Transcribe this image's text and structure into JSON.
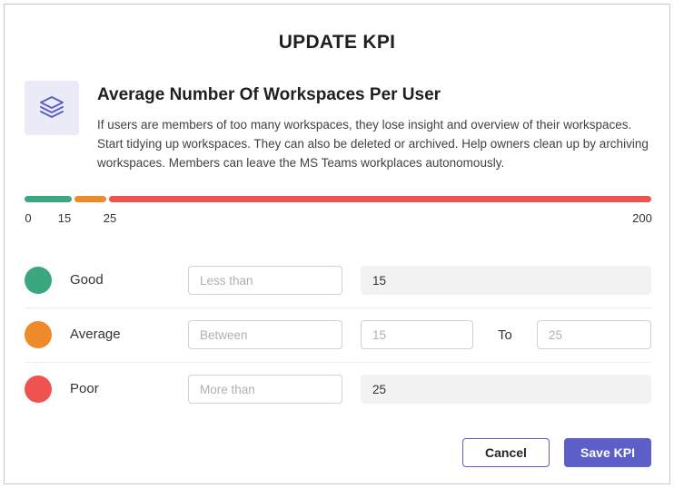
{
  "dialog": {
    "title": "UPDATE KPI"
  },
  "kpi": {
    "icon": "layers-icon",
    "name": "Average Number Of Workspaces Per User",
    "description": "If users are members of too many workspaces, they lose insight and overview of their workspaces. Start tidying up workspaces. They can also be deleted or archived. Help owners clean up by archiving workspaces. Members can leave the MS Teams workplaces autonomously."
  },
  "range": {
    "min": 0,
    "max": 200,
    "good_max": 15,
    "average_max": 25,
    "ticks": [
      "0",
      "15",
      "25",
      "200"
    ]
  },
  "colors": {
    "good": "#3aa77f",
    "average": "#ef8a2a",
    "poor": "#ef5350",
    "accent": "#5b5fc7"
  },
  "rows": [
    {
      "label": "Good",
      "operator_placeholder": "Less than",
      "value": "15"
    },
    {
      "label": "Average",
      "operator_placeholder": "Between",
      "from_value": "15",
      "to_label": "To",
      "to_value": "25"
    },
    {
      "label": "Poor",
      "operator_placeholder": "More than",
      "value": "25"
    }
  ],
  "buttons": {
    "cancel": "Cancel",
    "save": "Save KPI"
  }
}
